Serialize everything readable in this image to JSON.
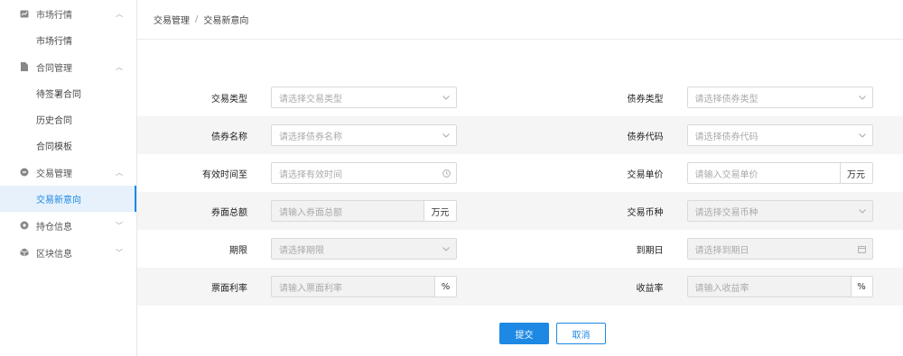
{
  "sidebar": {
    "groups": [
      {
        "label": "市场行情",
        "icon": "chart-icon",
        "expanded": true,
        "items": [
          {
            "label": "市场行情",
            "active": false
          }
        ]
      },
      {
        "label": "合同管理",
        "icon": "file-icon",
        "expanded": true,
        "items": [
          {
            "label": "待签署合同",
            "active": false
          },
          {
            "label": "历史合同",
            "active": false
          },
          {
            "label": "合同模板",
            "active": false
          }
        ]
      },
      {
        "label": "交易管理",
        "icon": "circle-icon",
        "expanded": true,
        "items": [
          {
            "label": "交易新意向",
            "active": true
          }
        ]
      },
      {
        "label": "持仓信息",
        "icon": "gear-icon",
        "expanded": false,
        "items": []
      },
      {
        "label": "区块信息",
        "icon": "cube-icon",
        "expanded": false,
        "items": []
      }
    ]
  },
  "breadcrumb": {
    "parent": "交易管理",
    "separator": "/",
    "current": "交易新意向"
  },
  "form": {
    "rows": [
      {
        "left": {
          "label": "交易类型",
          "placeholder": "请选择交易类型",
          "type": "select",
          "disabled": false
        },
        "right": {
          "label": "债券类型",
          "placeholder": "请选择债券类型",
          "type": "select",
          "disabled": false
        }
      },
      {
        "left": {
          "label": "债券名称",
          "placeholder": "请选择债券名称",
          "type": "select",
          "disabled": false
        },
        "right": {
          "label": "债券代码",
          "placeholder": "请选择债券代码",
          "type": "select",
          "disabled": false
        }
      },
      {
        "left": {
          "label": "有效时间至",
          "placeholder": "请选择有效时间",
          "type": "time",
          "disabled": false
        },
        "right": {
          "label": "交易单价",
          "placeholder": "请输入交易单价",
          "type": "unit",
          "unit": "万元",
          "disabled": false
        }
      },
      {
        "left": {
          "label": "券面总额",
          "placeholder": "请输入券面总额",
          "type": "unit",
          "unit": "万元",
          "disabled": true
        },
        "right": {
          "label": "交易币种",
          "placeholder": "请选择交易币种",
          "type": "select",
          "disabled": true
        }
      },
      {
        "left": {
          "label": "期限",
          "placeholder": "请选择期限",
          "type": "select",
          "disabled": true
        },
        "right": {
          "label": "到期日",
          "placeholder": "请选择到期日",
          "type": "date",
          "disabled": true
        }
      },
      {
        "left": {
          "label": "票面利率",
          "placeholder": "请输入票面利率",
          "type": "unit",
          "unit": "%",
          "disabled": true
        },
        "right": {
          "label": "收益率",
          "placeholder": "请输入收益率",
          "type": "unit",
          "unit": "%",
          "disabled": true
        }
      }
    ]
  },
  "buttons": {
    "submit": "提交",
    "cancel": "取消"
  },
  "colors": {
    "accent": "#1e88e5",
    "active_bg": "#e6f1fb",
    "stripe": "#f5f5f5"
  }
}
